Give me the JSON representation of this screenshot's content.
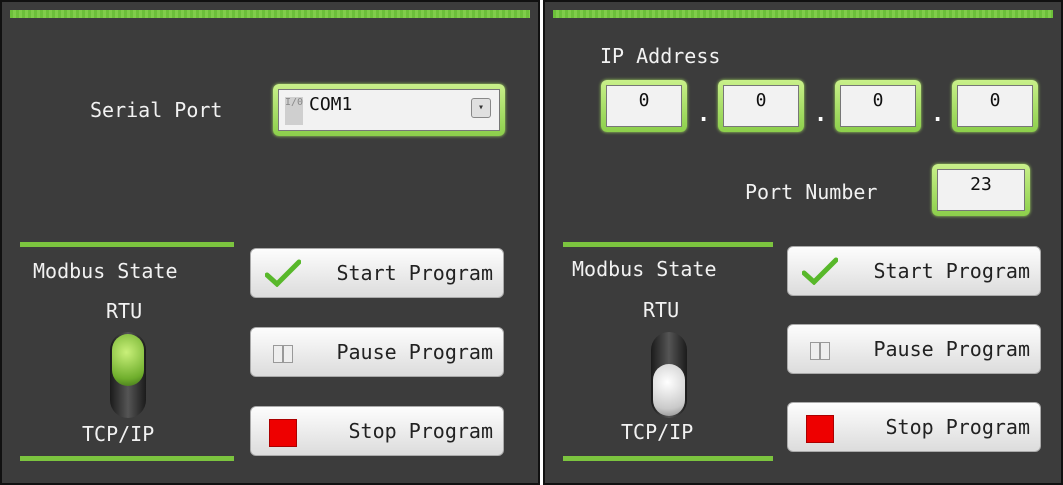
{
  "left_panel": {
    "serial_port_label": "Serial Port",
    "serial_port_value": "COM1",
    "io_icon_text": "I/0",
    "modbus_state_label": "Modbus State",
    "rtu_label": "RTU",
    "tcpip_label": "TCP/IP",
    "toggle_state": "RTU",
    "buttons": {
      "start": "Start Program",
      "pause": "Pause Program",
      "stop": "Stop Program"
    }
  },
  "right_panel": {
    "ip_address_label": "IP Address",
    "ip_octets": [
      "0",
      "0",
      "0",
      "0"
    ],
    "ip_separator": ".",
    "port_number_label": "Port Number",
    "port_number_value": "23",
    "modbus_state_label": "Modbus State",
    "rtu_label": "RTU",
    "tcpip_label": "TCP/IP",
    "toggle_state": "TCP/IP",
    "buttons": {
      "start": "Start Program",
      "pause": "Pause Program",
      "stop": "Stop Program"
    }
  },
  "colors": {
    "accent_green": "#7cc43f",
    "panel_bg": "#3c3c3c",
    "stop_red": "#ee0000"
  }
}
